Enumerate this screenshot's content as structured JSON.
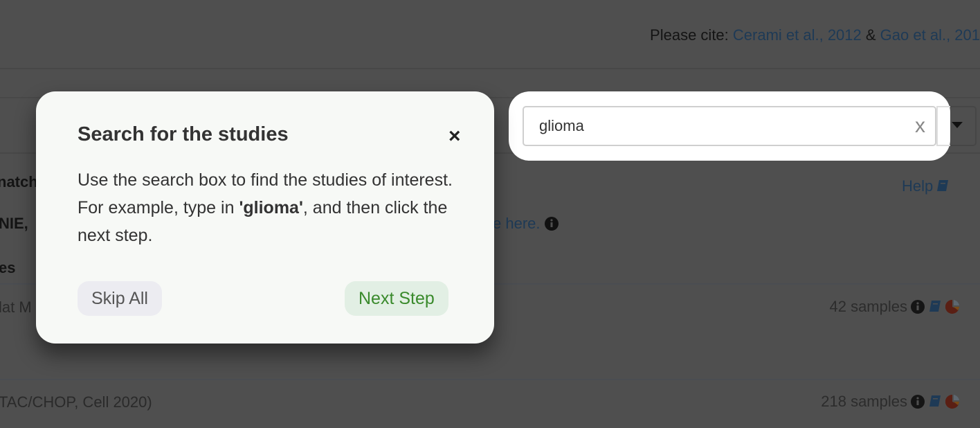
{
  "header": {
    "cite_prefix": "Please cite: ",
    "cite_link1": "Cerami et al., 2012",
    "cite_amp": " & ",
    "cite_link2": "Gao et al., 201"
  },
  "background": {
    "match_fragment": "natch",
    "nie_fragment": "NIE,",
    "here_link": "e here.",
    "help_link": "Help",
    "section_fragment": "es",
    "rows": [
      {
        "name": "lat M",
        "samples": "42 samples"
      },
      {
        "name": "TAC/CHOP, Cell 2020)",
        "samples": "218 samples"
      }
    ]
  },
  "search": {
    "value": "glioma",
    "clear_label": "x"
  },
  "tour": {
    "title": "Search for the studies",
    "close": "×",
    "body_1": "Use the search box to find the studies of interest. For example, type in ",
    "body_bold": "'glioma'",
    "body_2": ", and then click the next step.",
    "skip_label": "Skip All",
    "next_label": "Next Step"
  },
  "icons": {
    "info": "info-circle-icon",
    "book": "book-icon",
    "pie": "pie-chart-icon"
  },
  "colors": {
    "overlay": "#4f4f4f",
    "link": "#1e3a56",
    "next_text": "#3a8a2c",
    "next_bg": "#e2efe4",
    "skip_bg": "#ececf1"
  }
}
